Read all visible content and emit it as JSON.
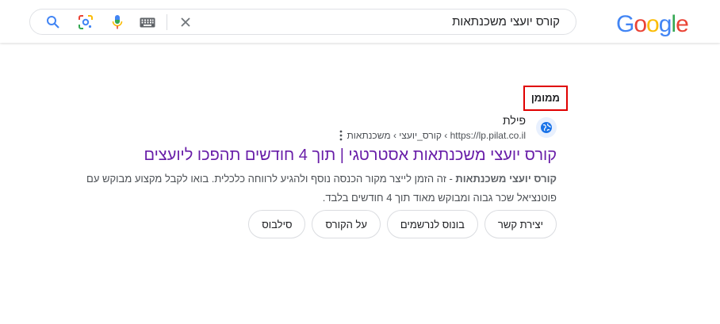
{
  "logo": {
    "letters": [
      "G",
      "o",
      "o",
      "g",
      "l",
      "e"
    ],
    "colors": [
      "#4285F4",
      "#EA4335",
      "#FBBC05",
      "#4285F4",
      "#34A853",
      "#EA4335"
    ]
  },
  "search": {
    "query": "קורס יועצי משכנתאות"
  },
  "ad": {
    "sponsored_label": "ממומן",
    "site_name": "פילת",
    "url": "https://lp.pilat.co.il › קורס_יועצי › משכנתאות",
    "title": "קורס יועצי משכנתאות אסטרטגי | תוך 4 חודשים תהפכו ליועצים",
    "snippet_bold": "קורס יועצי משכנתאות",
    "snippet_rest": " - זה הזמן לייצר מקור הכנסה נוסף ולהגיע לרווחה כלכלית. בואו לקבל מקצוע מבוקש עם פוטנציאל שכר גבוה ומבוקש מאוד תוך 4 חודשים בלבד.",
    "sitelinks": [
      "סילבוס",
      "על הקורס",
      "בונוס לנרשמים",
      "יצירת קשר"
    ]
  },
  "colors": {
    "title_visited": "#681da8",
    "highlight_border": "#e00000"
  }
}
